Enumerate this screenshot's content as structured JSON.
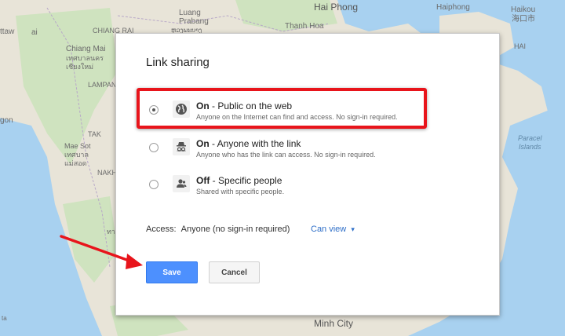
{
  "map": {
    "labels": {
      "luang_prabang": "Luang\nPrabang",
      "luang_thai": "ຫຼວງພະບາງ",
      "hai_phong": "Hai Phong",
      "thanh_hoa": "Thanh Hoa",
      "hanoi_fragment": "Haiphong",
      "haikou": "Haikou",
      "haikou_cn": "海口市",
      "chiang_rai": "CHIANG RAI",
      "chiang_mai": "Chiang Mai",
      "chiang_mai_thai": "เทศบาลนคร\nเชียงใหม่",
      "lampang": "LAMPAN",
      "mae_sot": "Mae Sot\nเทศบาล\nแม่สอด",
      "tak": "TAK",
      "nakhon": "NAKH",
      "gon": "gon",
      "ttaw": "ttaw",
      "paracel": "Paracel\nIslands",
      "hainan": "HAI",
      "minh_city": "Minh City",
      "ta_bottom": "ta",
      "ai": "ai",
      "tha": "ทา"
    },
    "colors": {
      "water": "#a8d1f0",
      "land": "#e8e4d8",
      "forest": "#cfe3bf"
    }
  },
  "dialog": {
    "title": "Link sharing",
    "options": [
      {
        "bold": "On",
        "rest": " - Public on the web",
        "desc": "Anyone on the Internet can find and access. No sign-in required.",
        "icon": "globe-icon",
        "checked": true
      },
      {
        "bold": "On",
        "rest": " - Anyone with the link",
        "desc": "Anyone who has the link can access. No sign-in required.",
        "icon": "incognito-icon",
        "checked": false
      },
      {
        "bold": "Off",
        "rest": " - Specific people",
        "desc": "Shared with specific people.",
        "icon": "person-icon",
        "checked": false
      }
    ],
    "access_label": "Access:",
    "access_value": "Anyone (no sign-in required)",
    "can_view": "Can view",
    "can_view_caret": "▾",
    "save_label": "Save",
    "cancel_label": "Cancel"
  },
  "annotations": {
    "highlight_color": "#e8141b",
    "arrow_color": "#e8141b"
  }
}
